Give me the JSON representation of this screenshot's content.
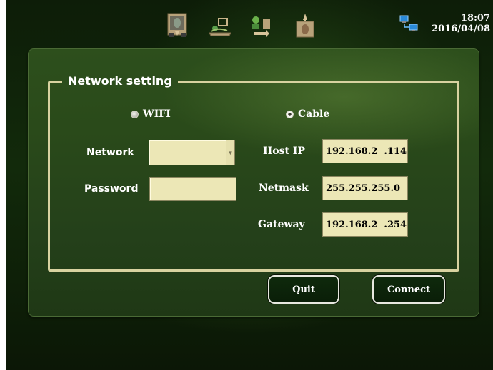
{
  "topbar": {
    "icons": [
      "cabinet-download-icon",
      "patient-monitor-icon",
      "transfer-icon",
      "cabinet-upload-icon"
    ],
    "network_icon": "network-computers-icon",
    "time": "18:07",
    "date": "2016/04/08"
  },
  "panel": {
    "title": "Network setting",
    "connection": {
      "wifi_label": "WIFI",
      "cable_label": "Cable",
      "selected": "Cable"
    },
    "wifi": {
      "network_label": "Network",
      "network_value": "",
      "password_label": "Password",
      "password_value": ""
    },
    "cable": {
      "host_ip_label": "Host IP",
      "host_ip_value": "192.168.2  .114",
      "netmask_label": "Netmask",
      "netmask_value": "255.255.255.0",
      "gateway_label": "Gateway",
      "gateway_value": "192.168.2  .254"
    }
  },
  "buttons": {
    "quit": "Quit",
    "connect": "Connect"
  },
  "colors": {
    "background": "#122a0b",
    "panel": "#2a4a1a",
    "frame": "#d8d2a0",
    "field": "#ece7b6"
  }
}
